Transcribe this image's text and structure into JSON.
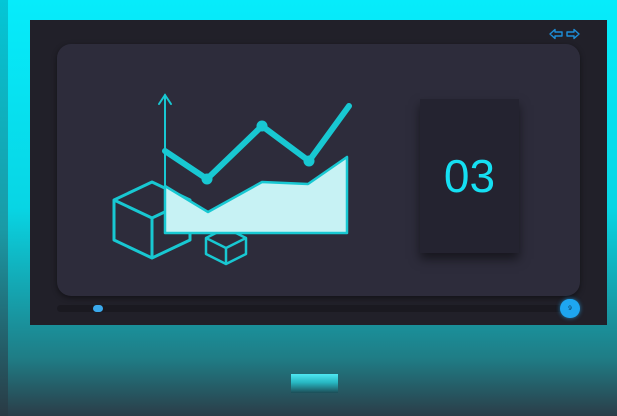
{
  "slide": {
    "number": "03",
    "page_badge": "9",
    "progress": 0.08
  },
  "icons": {
    "prev": "arrow-left-icon",
    "next": "arrow-right-icon",
    "illustration": "line-area-chart-with-cubes-icon"
  },
  "colors": {
    "accent_cyan": "#18c8d2",
    "number_text": "#15dff2",
    "area_fill": "#c7f2f4",
    "screen_bg": "#212029",
    "panel_bg": "#2d2c3b",
    "slider_handle": "#3aa9ec",
    "badge": "#1ea6f1"
  }
}
